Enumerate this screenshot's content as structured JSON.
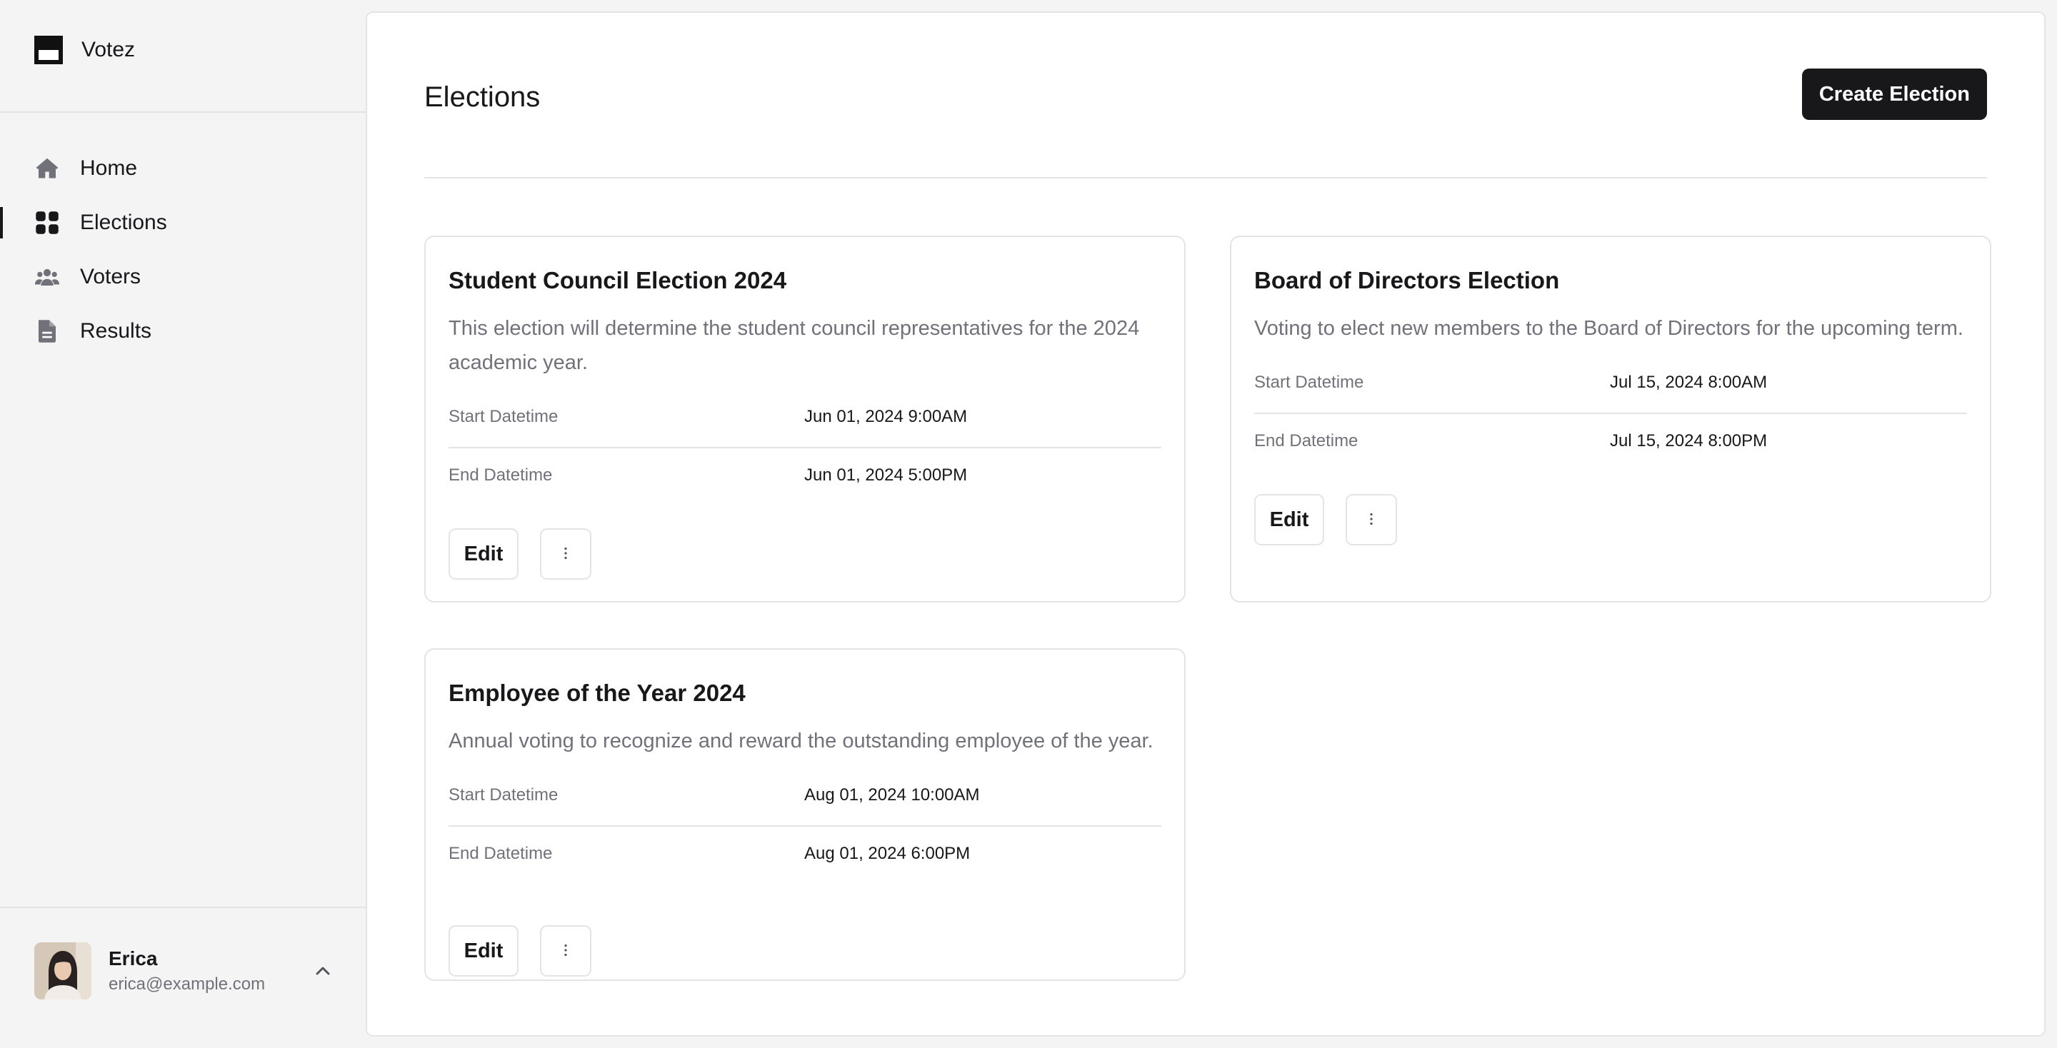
{
  "app": {
    "name": "Votez"
  },
  "sidebar": {
    "items": [
      {
        "label": "Home",
        "icon": "home-icon",
        "active": false
      },
      {
        "label": "Elections",
        "icon": "grid-icon",
        "active": true
      },
      {
        "label": "Voters",
        "icon": "users-icon",
        "active": false
      },
      {
        "label": "Results",
        "icon": "document-icon",
        "active": false
      }
    ]
  },
  "user": {
    "name": "Erica",
    "email": "erica@example.com",
    "menu_icon": "chevron-up-icon"
  },
  "page": {
    "title": "Elections",
    "create_label": "Create Election"
  },
  "cards": [
    {
      "title": "Student Council Election 2024",
      "description": "This election will determine the student council representatives for the 2024 academic year.",
      "start_label": "Start Datetime",
      "start_value": "Jun 01, 2024 9:00AM",
      "end_label": "End Datetime",
      "end_value": "Jun 01, 2024 5:00PM",
      "edit_label": "Edit",
      "more_icon": "more-vertical-icon"
    },
    {
      "title": "Board of Directors Election",
      "description": "Voting to elect new members to the Board of Directors for the upcoming term.",
      "start_label": "Start Datetime",
      "start_value": "Jul 15, 2024 8:00AM",
      "end_label": "End Datetime",
      "end_value": "Jul 15, 2024 8:00PM",
      "edit_label": "Edit",
      "more_icon": "more-vertical-icon"
    },
    {
      "title": "Employee of the Year 2024",
      "description": "Annual voting to recognize and reward the outstanding employee of the year.",
      "start_label": "Start Datetime",
      "start_value": "Aug 01, 2024 10:00AM",
      "end_label": "End Datetime",
      "end_value": "Aug 01, 2024 6:00PM",
      "edit_label": "Edit",
      "more_icon": "more-vertical-icon"
    }
  ],
  "colors": {
    "primary": "#18181b",
    "muted": "#71717a",
    "border": "#e4e4e7",
    "background": "#f4f4f5"
  }
}
